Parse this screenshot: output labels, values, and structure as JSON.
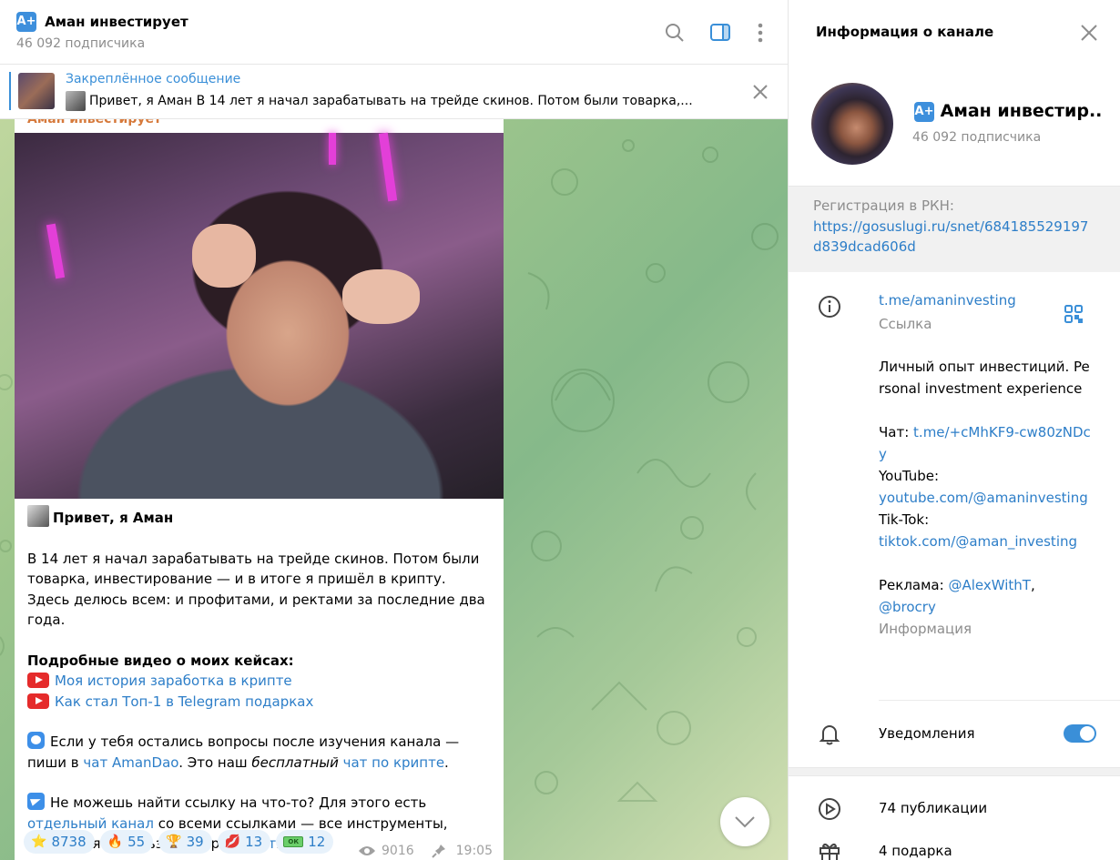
{
  "header": {
    "channel_badge": "A+",
    "channel_name": "Аман инвестирует",
    "subscribers": "46 092 подписчика"
  },
  "pinned": {
    "label": "Закреплённое сообщение",
    "text": "Привет, я Аман  В 14 лет я начал зарабатывать на трейде скинов. Потом были товарка,..."
  },
  "message": {
    "author": "Аман инвестирует",
    "greeting": "Привет, я Аман",
    "intro": "В 14 лет я начал зарабатывать на трейде скинов. Потом были товарка, инвестирование — и в итоге я пришёл в крипту. Здесь делюсь всем: и профитами, и ректами за последние два года.",
    "videos_heading": "Подробные видео о моих кейсах:",
    "video1": "Моя история заработка в крипте",
    "video2": "Как стал Топ-1 в Telegram подарках",
    "q_pre": "Если у тебя остались вопросы после изучения канала — пиши в ",
    "q_link": "чат AmanDao",
    "q_mid": ". Это наш ",
    "q_em": "бесплатный",
    "q_sp": " ",
    "q_link2": "чат по крипте",
    "q_end": ".",
    "f_pre": "Не можешь найти ссылку на что-то? Для этого есть ",
    "f_link": "отдельный канал",
    "f_mid": " со всеми ссылками — все инструменты, которые я использую собраны ",
    "f_link2": "тут",
    "f_end": ".",
    "reactions": [
      {
        "icon": "star-icon",
        "glyph": "⭐",
        "count": "8738"
      },
      {
        "icon": "fire-icon",
        "glyph": "🔥",
        "count": "55"
      },
      {
        "icon": "trophy-icon",
        "glyph": "🏆",
        "count": "39"
      },
      {
        "icon": "lips-icon",
        "glyph": "💋",
        "count": "13"
      },
      {
        "icon": "cash-icon",
        "glyph": "ОК",
        "count": "12"
      }
    ],
    "views": "9016",
    "time": "19:05"
  },
  "info": {
    "title": "Информация о канале",
    "channel_badge": "A+",
    "channel_name": "Аман инвестир...",
    "subscribers": "46 092 подписчика",
    "rkn_label": "Регистрация в РКН:",
    "rkn_url": "https://gosuslugi.ru/snet/684185529197d839dcad606d",
    "link": "t.me/amaninvesting",
    "link_label": "Ссылка",
    "desc_line1": "Личный опыт инвестиций. Personal investment experience",
    "chat_label": "Чат: ",
    "chat_link": "t.me/+cMhKF9-cw80zNDcy",
    "yt_label": "YouTube:",
    "yt_link": "youtube.com/@amaninvesting",
    "tt_label": "Tik-Tok:",
    "tt_link": "tiktok.com/@aman_investing",
    "ad_label": "Реклама: ",
    "ad_link1": "@AlexWithT",
    "ad_sep": ",",
    "ad_link2": "@brocry",
    "desc_sub": "Информация",
    "notifications": "Уведомления",
    "notifications_on": true,
    "posts": "74 публикации",
    "gifts": "4 подарка"
  },
  "colors": {
    "accent": "#3a8fd8",
    "link": "#2d7ec8",
    "author": "#d67a3c"
  }
}
